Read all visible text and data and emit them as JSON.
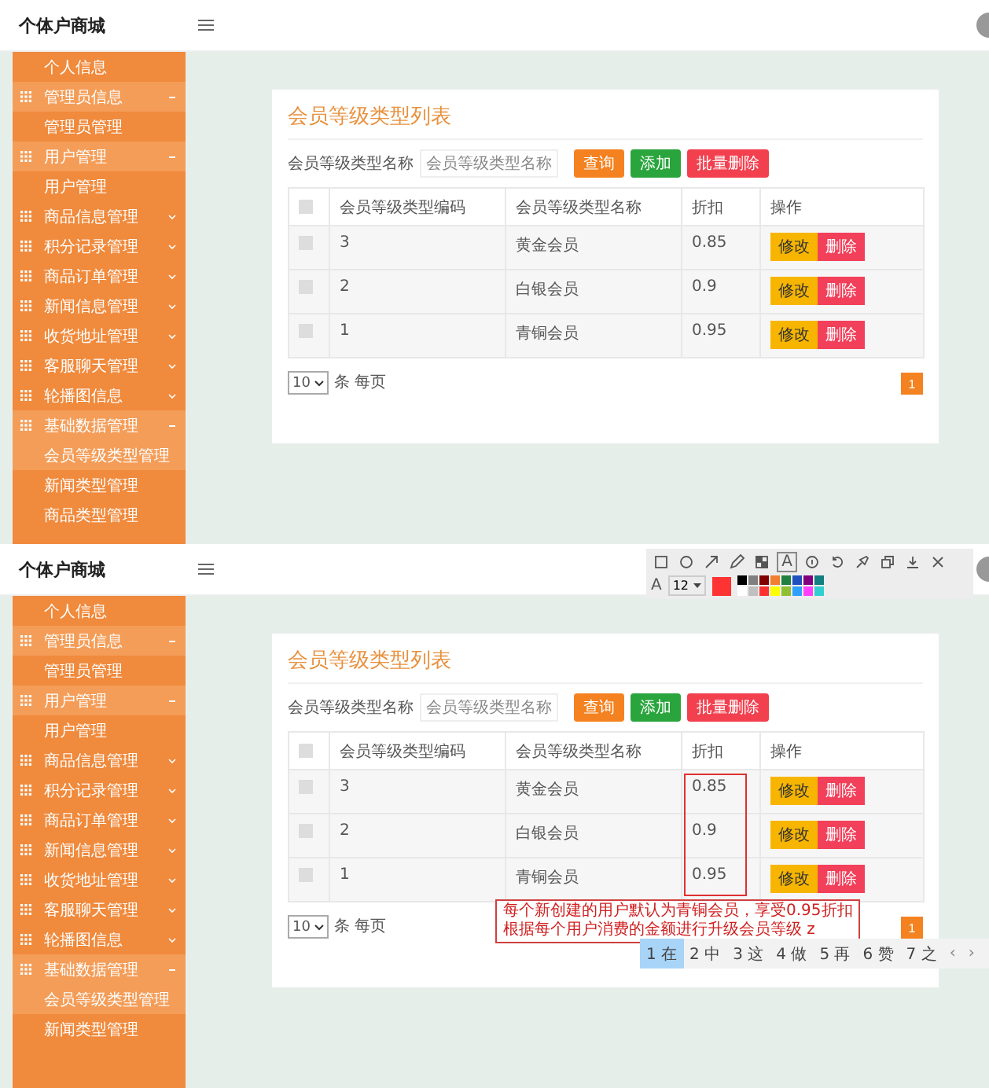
{
  "screens": [
    {
      "header": {
        "title": "个体户商城"
      },
      "sidebar": [
        {
          "label": "个人信息",
          "kind": "sub",
          "selected": false
        },
        {
          "label": "管理员信息",
          "kind": "group",
          "expanded": true
        },
        {
          "label": "管理员管理",
          "kind": "sub",
          "selected": false
        },
        {
          "label": "用户管理",
          "kind": "group",
          "expanded": true
        },
        {
          "label": "用户管理",
          "kind": "sub",
          "selected": false
        },
        {
          "label": "商品信息管理",
          "kind": "group",
          "expanded": false
        },
        {
          "label": "积分记录管理",
          "kind": "group",
          "expanded": false
        },
        {
          "label": "商品订单管理",
          "kind": "group",
          "expanded": false
        },
        {
          "label": "新闻信息管理",
          "kind": "group",
          "expanded": false
        },
        {
          "label": "收货地址管理",
          "kind": "group",
          "expanded": false
        },
        {
          "label": "客服聊天管理",
          "kind": "group",
          "expanded": false
        },
        {
          "label": "轮播图信息",
          "kind": "group",
          "expanded": false
        },
        {
          "label": "基础数据管理",
          "kind": "group",
          "expanded": true
        },
        {
          "label": "会员等级类型管理",
          "kind": "sub",
          "selected": true
        },
        {
          "label": "新闻类型管理",
          "kind": "sub",
          "selected": false
        },
        {
          "label": "商品类型管理",
          "kind": "sub",
          "selected": false
        }
      ],
      "card": {
        "title": "会员等级类型列表",
        "search": {
          "label": "会员等级类型名称",
          "placeholder": "会员等级类型名称"
        },
        "buttons": [
          {
            "label": "查询",
            "kind": "query"
          },
          {
            "label": "添加",
            "kind": "add"
          },
          {
            "label": "批量删除",
            "kind": "delete"
          }
        ],
        "table": {
          "header_checked": false,
          "columns": [
            {
              "label": "会员等级类型编码",
              "boxed": false
            },
            {
              "label": "会员等级类型名称",
              "boxed": false
            },
            {
              "label": "折扣",
              "boxed": false
            },
            {
              "label": "操作",
              "boxed": false
            }
          ],
          "rows": [
            {
              "checked": false,
              "cells": [
                "3",
                "黄金会员",
                "0.85"
              ],
              "actions": [
                {
                  "label": "修改",
                  "kind": "edit"
                },
                {
                  "label": "删除",
                  "kind": "delete"
                }
              ]
            },
            {
              "checked": false,
              "cells": [
                "2",
                "白银会员",
                "0.9"
              ],
              "actions": [
                {
                  "label": "修改",
                  "kind": "edit"
                },
                {
                  "label": "删除",
                  "kind": "delete"
                }
              ]
            },
            {
              "checked": false,
              "cells": [
                "1",
                "青铜会员",
                "0.95"
              ],
              "actions": [
                {
                  "label": "修改",
                  "kind": "edit"
                },
                {
                  "label": "删除",
                  "kind": "delete"
                }
              ]
            }
          ]
        },
        "page_size": "10",
        "page_size_suffix": "条 每页",
        "pages": [
          {
            "label": "1",
            "selected": true
          }
        ]
      }
    },
    {
      "header": {
        "title": "个体户商城"
      },
      "toolbar": {
        "tools": [
          {
            "kind": "rect",
            "selected": false
          },
          {
            "kind": "ellipse",
            "selected": false
          },
          {
            "kind": "arrow",
            "selected": false
          },
          {
            "kind": "pen",
            "selected": false
          },
          {
            "kind": "mosaic",
            "selected": false
          },
          {
            "kind": "text",
            "label": "A",
            "selected": true
          },
          {
            "kind": "number",
            "selected": false
          },
          {
            "kind": "undo",
            "selected": false
          },
          {
            "kind": "pin",
            "selected": false
          },
          {
            "kind": "copy",
            "selected": false
          },
          {
            "kind": "save",
            "selected": false
          },
          {
            "kind": "close",
            "selected": false
          }
        ],
        "text_label": "A",
        "font_size": "12",
        "current": {
          "color": "#ff3333"
        },
        "palette": [
          {
            "color": "#000000"
          },
          {
            "color": "#808080"
          },
          {
            "color": "#800000"
          },
          {
            "color": "#f08030"
          },
          {
            "color": "#208040"
          },
          {
            "color": "#2050c0"
          },
          {
            "color": "#800080"
          },
          {
            "color": "#108080"
          },
          {
            "color": "#ffffff"
          },
          {
            "color": "#c0c0c0"
          },
          {
            "color": "#ff3030"
          },
          {
            "color": "#ffff00"
          },
          {
            "color": "#90c030"
          },
          {
            "color": "#30a0ff"
          },
          {
            "color": "#ff40ff"
          },
          {
            "color": "#30d0d0"
          }
        ]
      },
      "sidebar": [
        {
          "label": "个人信息",
          "kind": "sub",
          "selected": false
        },
        {
          "label": "管理员信息",
          "kind": "group",
          "expanded": true
        },
        {
          "label": "管理员管理",
          "kind": "sub",
          "selected": false
        },
        {
          "label": "用户管理",
          "kind": "group",
          "expanded": true
        },
        {
          "label": "用户管理",
          "kind": "sub",
          "selected": false
        },
        {
          "label": "商品信息管理",
          "kind": "group",
          "expanded": false
        },
        {
          "label": "积分记录管理",
          "kind": "group",
          "expanded": false
        },
        {
          "label": "商品订单管理",
          "kind": "group",
          "expanded": false
        },
        {
          "label": "新闻信息管理",
          "kind": "group",
          "expanded": false
        },
        {
          "label": "收货地址管理",
          "kind": "group",
          "expanded": false
        },
        {
          "label": "客服聊天管理",
          "kind": "group",
          "expanded": false
        },
        {
          "label": "轮播图信息",
          "kind": "group",
          "expanded": false
        },
        {
          "label": "基础数据管理",
          "kind": "group",
          "expanded": true
        },
        {
          "label": "会员等级类型管理",
          "kind": "sub",
          "selected": true
        },
        {
          "label": "新闻类型管理",
          "kind": "sub",
          "selected": false
        }
      ],
      "card": {
        "title": "会员等级类型列表",
        "search": {
          "label": "会员等级类型名称",
          "placeholder": "会员等级类型名称"
        },
        "buttons": [
          {
            "label": "查询",
            "kind": "query"
          },
          {
            "label": "添加",
            "kind": "add"
          },
          {
            "label": "批量删除",
            "kind": "delete"
          }
        ],
        "table": {
          "header_checked": false,
          "columns": [
            {
              "label": "会员等级类型编码",
              "boxed": false
            },
            {
              "label": "会员等级类型名称",
              "boxed": false
            },
            {
              "label": "折扣",
              "boxed": true
            },
            {
              "label": "操作",
              "boxed": false
            }
          ],
          "rows": [
            {
              "checked": false,
              "cells": [
                "3",
                "黄金会员",
                "0.85"
              ],
              "actions": [
                {
                  "label": "修改",
                  "kind": "edit"
                },
                {
                  "label": "删除",
                  "kind": "delete"
                }
              ]
            },
            {
              "checked": false,
              "cells": [
                "2",
                "白银会员",
                "0.9"
              ],
              "actions": [
                {
                  "label": "修改",
                  "kind": "edit"
                },
                {
                  "label": "删除",
                  "kind": "delete"
                }
              ]
            },
            {
              "checked": false,
              "cells": [
                "1",
                "青铜会员",
                "0.95"
              ],
              "actions": [
                {
                  "label": "修改",
                  "kind": "edit"
                },
                {
                  "label": "删除",
                  "kind": "delete"
                }
              ]
            }
          ]
        },
        "page_size": "10",
        "page_size_suffix": "条 每页",
        "note": [
          "每个新创建的用户默认为青铜会员，享受0.95折扣",
          "根据每个用户消费的金额进行升级会员等级 z"
        ],
        "pages": [
          {
            "label": "1",
            "selected": true
          }
        ]
      },
      "ime": {
        "candidates": [
          {
            "label": "1 在",
            "selected": true
          },
          {
            "label": "2 中",
            "selected": false
          },
          {
            "label": "3 这",
            "selected": false
          },
          {
            "label": "4 做",
            "selected": false
          },
          {
            "label": "5 再",
            "selected": false
          },
          {
            "label": "6 赞",
            "selected": false
          },
          {
            "label": "7 之",
            "selected": false
          }
        ],
        "nav": [
          "‹",
          "›"
        ]
      }
    }
  ]
}
